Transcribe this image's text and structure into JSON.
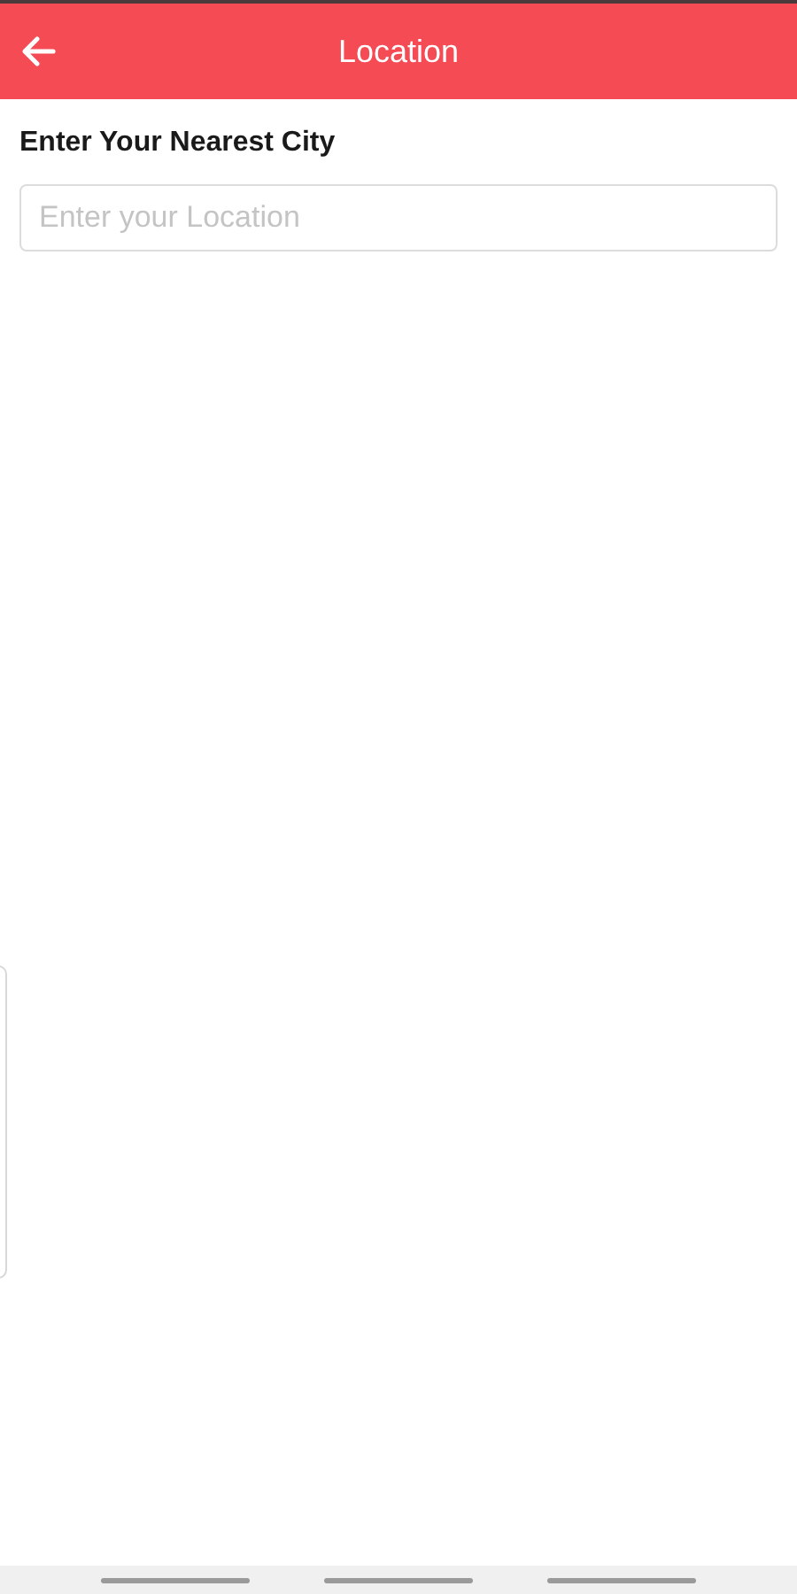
{
  "header": {
    "title": "Location"
  },
  "form": {
    "label": "Enter Your Nearest City",
    "location_field": {
      "placeholder": "Enter your Location"
    }
  }
}
